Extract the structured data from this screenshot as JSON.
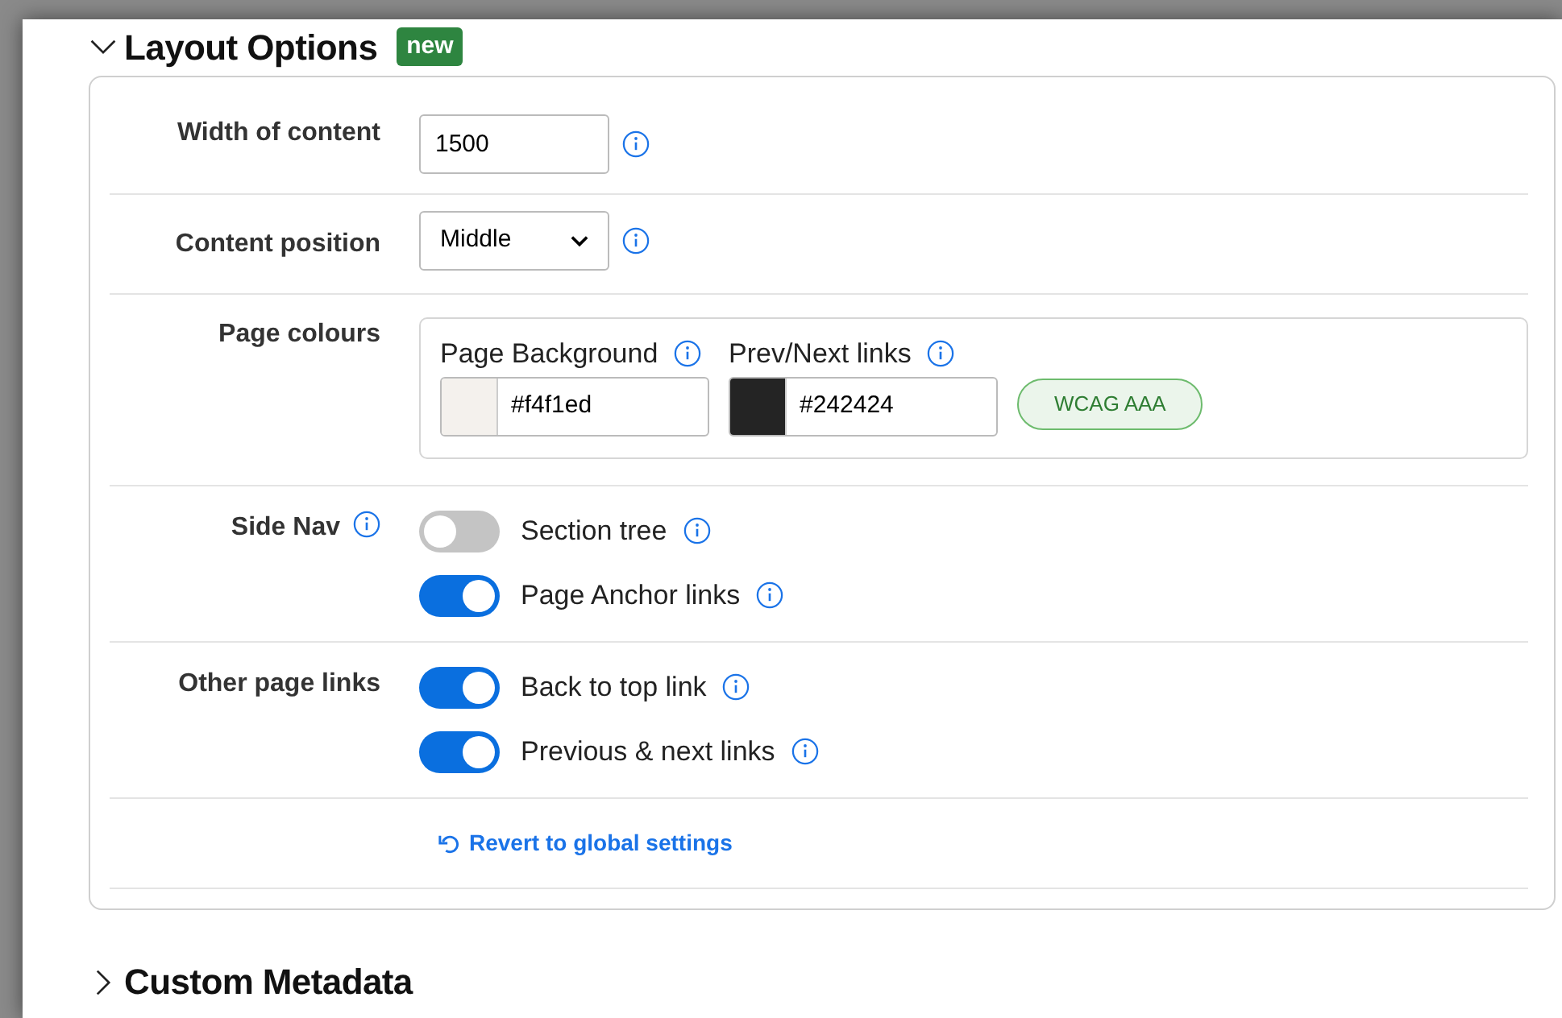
{
  "layout_options": {
    "title": "Layout Options",
    "expanded": true,
    "badge": "new",
    "fields": [
      {
        "kind": "text",
        "label": "Width of content",
        "label_info": false,
        "value": "1500"
      },
      {
        "kind": "select",
        "label": "Content position",
        "label_info": false,
        "value": "Middle"
      },
      {
        "kind": "colours",
        "label": "Page colours",
        "label_info": false,
        "colours": [
          {
            "label": "Page Background",
            "value": "#f4f1ed",
            "color": "#f4f1ed"
          },
          {
            "label": "Prev/Next links",
            "value": "#242424",
            "color": "#242424"
          }
        ],
        "contrast_badge": "WCAG AAA"
      },
      {
        "kind": "toggles",
        "label": "Side Nav",
        "label_info": true,
        "toggles": [
          {
            "label": "Section tree",
            "on": false
          },
          {
            "label": "Page Anchor links",
            "on": true
          }
        ]
      },
      {
        "kind": "toggles",
        "label": "Other page links",
        "label_info": false,
        "toggles": [
          {
            "label": "Back to top link",
            "on": true
          },
          {
            "label": "Previous & next links",
            "on": true
          }
        ]
      }
    ],
    "revert_link": "Revert to global settings"
  },
  "custom_metadata": {
    "title": "Custom Metadata",
    "expanded": false
  }
}
